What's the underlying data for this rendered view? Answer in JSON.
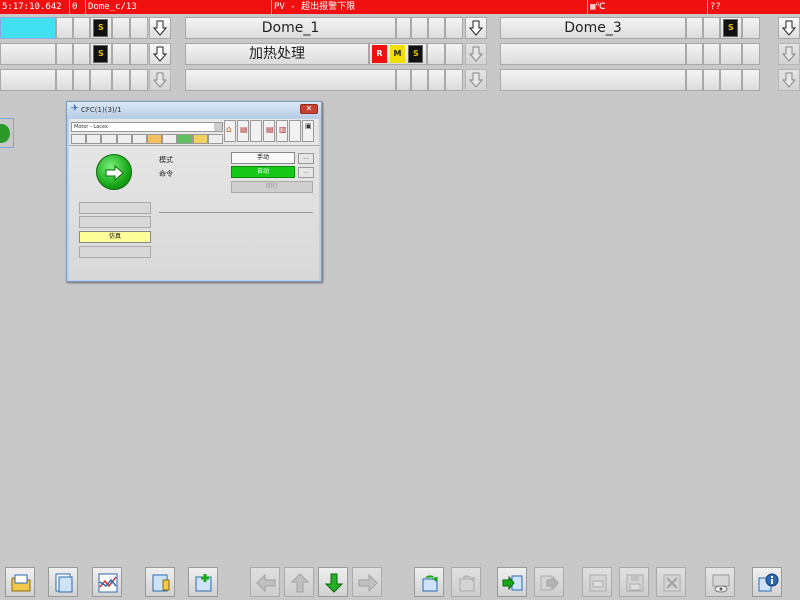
{
  "alarm_bar": {
    "time": "5:17:10.642",
    "count": "0",
    "source": "Dome_c/13",
    "message": "PV - 超出报警下限",
    "unit": "℃",
    "status": "??"
  },
  "areas": {
    "row1": {
      "left_label": "",
      "mid_label": "Dome_1",
      "right_label": "Dome_3"
    },
    "row2": {
      "mid_label": "加热处理",
      "badge_red": "R",
      "badge_yellow": "M"
    },
    "row3": {}
  },
  "faceplate": {
    "title": "CFC(1)(3)/1",
    "combo_value": "Motor - Lacex",
    "mode_label": "模式",
    "command_label": "命令",
    "manual_button": "手动",
    "auto_button": "自动",
    "disabled_button": "回行",
    "sim_label": "仿真",
    "more_label": "..."
  },
  "colors": {
    "alarm": "#f01010",
    "accent_cyan": "#40e0f0",
    "active_green": "#18c818",
    "sim_yellow": "#ffff9a"
  },
  "bottom_toolbar": {
    "icons": [
      "open-folder-icon",
      "overview-icon",
      "trend-icon",
      "report-icon",
      "add-icon",
      "back-arrow-icon",
      "up-arrow-icon",
      "down-arrow-icon",
      "forward-arrow-icon",
      "refresh-icon",
      "redo-icon",
      "import-icon",
      "export-icon",
      "print-icon",
      "save-icon",
      "delete-icon",
      "view-icon",
      "info-icon"
    ]
  }
}
